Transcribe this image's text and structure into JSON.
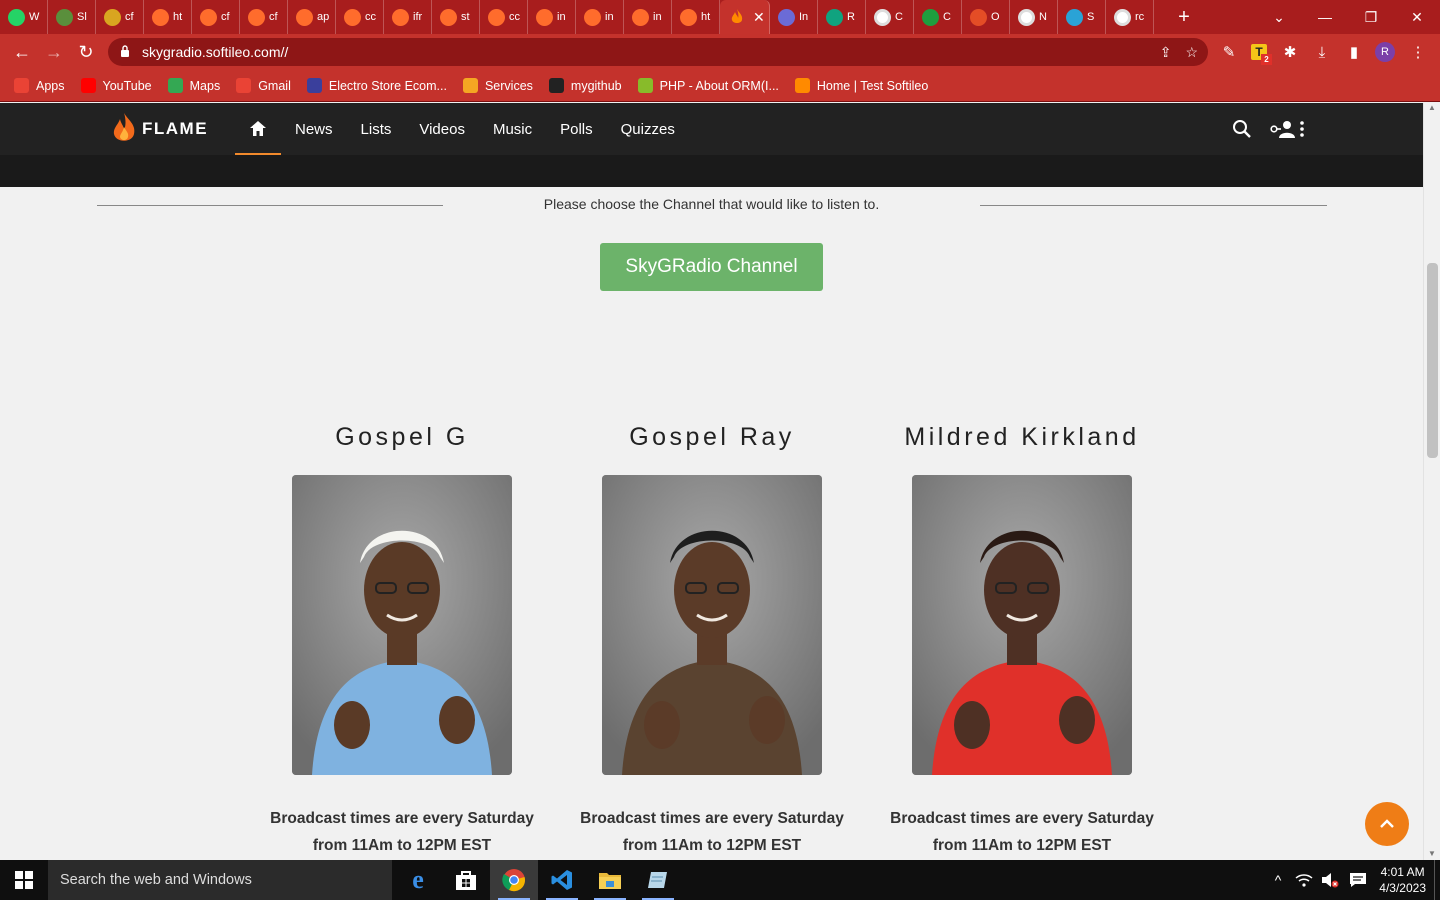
{
  "browser": {
    "tabs": [
      {
        "title": "W",
        "icon": "whatsapp-icon",
        "color": "#25d366"
      },
      {
        "title": "Sl",
        "icon": "skyg-icon",
        "color": "#5a8f3c"
      },
      {
        "title": "cf",
        "icon": "shield-icon",
        "color": "#d9a520"
      },
      {
        "title": "ht",
        "icon": "cp-icon",
        "color": "#ff6c2c"
      },
      {
        "title": "cf",
        "icon": "cp-icon",
        "color": "#ff6c2c"
      },
      {
        "title": "cf",
        "icon": "cp-icon",
        "color": "#ff6c2c"
      },
      {
        "title": "ap",
        "icon": "cp-icon",
        "color": "#ff6c2c"
      },
      {
        "title": "cc",
        "icon": "cp-icon",
        "color": "#ff6c2c"
      },
      {
        "title": "ifr",
        "icon": "cp-icon",
        "color": "#ff6c2c"
      },
      {
        "title": "st",
        "icon": "cp-icon",
        "color": "#ff6c2c"
      },
      {
        "title": "cc",
        "icon": "cp-icon",
        "color": "#ff6c2c"
      },
      {
        "title": "in",
        "icon": "cp-icon",
        "color": "#ff6c2c"
      },
      {
        "title": "in",
        "icon": "cp-icon",
        "color": "#ff6c2c"
      },
      {
        "title": "in",
        "icon": "cp-icon",
        "color": "#ff6c2c"
      },
      {
        "title": "ht",
        "icon": "cp-icon",
        "color": "#ff6c2c"
      }
    ],
    "active_tab": {
      "icon": "flame-icon",
      "close": "✕"
    },
    "tabs_after": [
      {
        "title": "In",
        "icon": "globe-icon",
        "color": "#6b6bd6"
      },
      {
        "title": "R",
        "icon": "openai-icon",
        "color": "#10a37f"
      },
      {
        "title": "C",
        "icon": "chrome-icon",
        "color": "#ffffff"
      },
      {
        "title": "C",
        "icon": "w-icon",
        "color": "#1e9e3e"
      },
      {
        "title": "O",
        "icon": "colorful-icon",
        "color": "#e44d26"
      },
      {
        "title": "N",
        "icon": "chrome-icon",
        "color": "#ffffff"
      },
      {
        "title": "S",
        "icon": "image-icon",
        "color": "#2aa3d6"
      },
      {
        "title": "rc",
        "icon": "google-icon",
        "color": "#ffffff"
      }
    ],
    "new_tab": "+",
    "url": "skygradio.softileo.com//",
    "bookmarks": [
      {
        "label": "Apps",
        "icon": "apps-grid-icon",
        "color": "#ea4335"
      },
      {
        "label": "YouTube",
        "icon": "youtube-icon",
        "color": "#ff0000"
      },
      {
        "label": "Maps",
        "icon": "maps-pin-icon",
        "color": "#34a853"
      },
      {
        "label": "Gmail",
        "icon": "gmail-icon",
        "color": "#ea4335"
      },
      {
        "label": "Electro Store Ecom...",
        "icon": "w3-icon",
        "color": "#3a3f9c"
      },
      {
        "label": "Services",
        "icon": "services-icon",
        "color": "#f5a623"
      },
      {
        "label": "mygithub",
        "icon": "github-icon",
        "color": "#222222"
      },
      {
        "label": "PHP - About ORM(I...",
        "icon": "php-icon",
        "color": "#88bb2a"
      },
      {
        "label": "Home | Test Softileo",
        "icon": "flame-icon",
        "color": "#ff8a00"
      }
    ],
    "profile_letter": "R",
    "extension_badge": "2"
  },
  "site": {
    "brand": "FLAME",
    "nav": [
      "News",
      "Lists",
      "Videos",
      "Music",
      "Polls",
      "Quizzes"
    ],
    "choose_text": "Please choose the Channel that would like to listen to.",
    "channel_button": "SkyGRadio Channel",
    "hosts": [
      {
        "name": "Gospel G",
        "times_line1": "Broadcast times are every Saturday",
        "times_line2": "from 11Am to 12PM EST",
        "shirt": "#7fb2e0",
        "cap": "#f4f4f0",
        "skin": "#5a3a26"
      },
      {
        "name": "Gospel Ray",
        "times_line1": "Broadcast times are every Saturday",
        "times_line2": "from 11Am to 12PM EST",
        "shirt": "#5a4330",
        "cap": "#1e1e1e",
        "skin": "#5b3b28"
      },
      {
        "name": "Mildred Kirkland",
        "times_line1": "Broadcast times are every Saturday",
        "times_line2": "from 11Am to 12PM EST",
        "shirt": "#e0302a",
        "cap": "#2a1a14",
        "skin": "#4e3024"
      }
    ],
    "accent": "#ef7d16",
    "button_color": "#6cb36a"
  },
  "taskbar": {
    "search_placeholder": "Search the web and Windows",
    "time": "4:01 AM",
    "date": "4/3/2023"
  }
}
